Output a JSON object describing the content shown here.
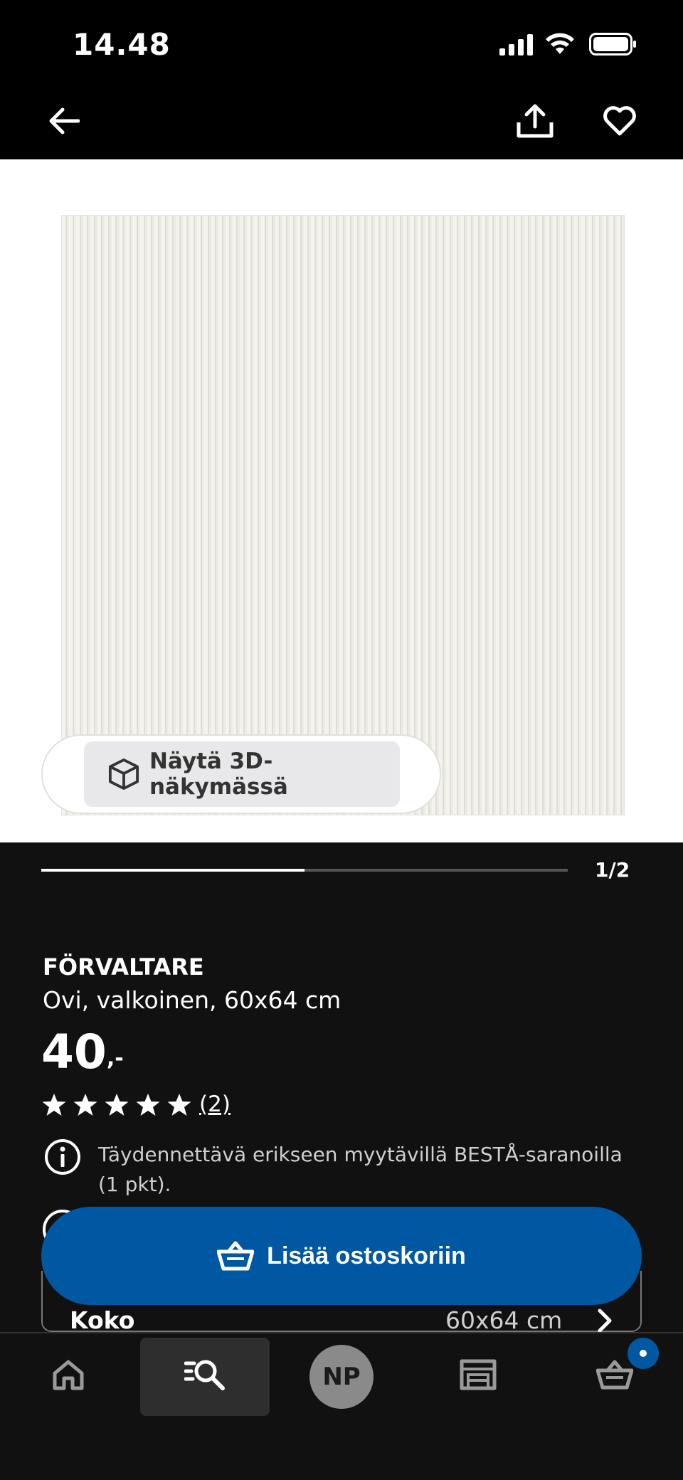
{
  "status_bar": {
    "time": "14.48",
    "icons": [
      "cellular-signal-icon",
      "wifi-icon",
      "battery-icon"
    ]
  },
  "top_nav": {
    "icons": [
      "back-arrow-icon",
      "share-icon",
      "heart-icon"
    ]
  },
  "gallery": {
    "view_3d_label": "Näytä 3D-näkymässä",
    "view_3d_icon": "cube-icon",
    "pager": "1/2",
    "progress": 0.5
  },
  "product": {
    "name": "FÖRVALTARE",
    "description": "Ovi, valkoinen, 60x64 cm",
    "price_value": "40",
    "price_suffix": ",-",
    "rating": 5,
    "review_count": "(2)",
    "info_text": "Täydennettävä erikseen myytävillä BESTÅ-saranoilla (1 pkt).",
    "size_label": "Koko",
    "size_value": "60x64 cm"
  },
  "actions": {
    "add_to_cart_label": "Lisää ostoskoriin"
  },
  "bottom_nav": {
    "items": [
      "home-icon",
      "search-icon",
      "profile-avatar",
      "store-icon",
      "cart-icon"
    ],
    "avatar_initials": "NP"
  },
  "colors": {
    "accent_blue": "#0058a3",
    "background": "#111111",
    "header": "#000000"
  }
}
